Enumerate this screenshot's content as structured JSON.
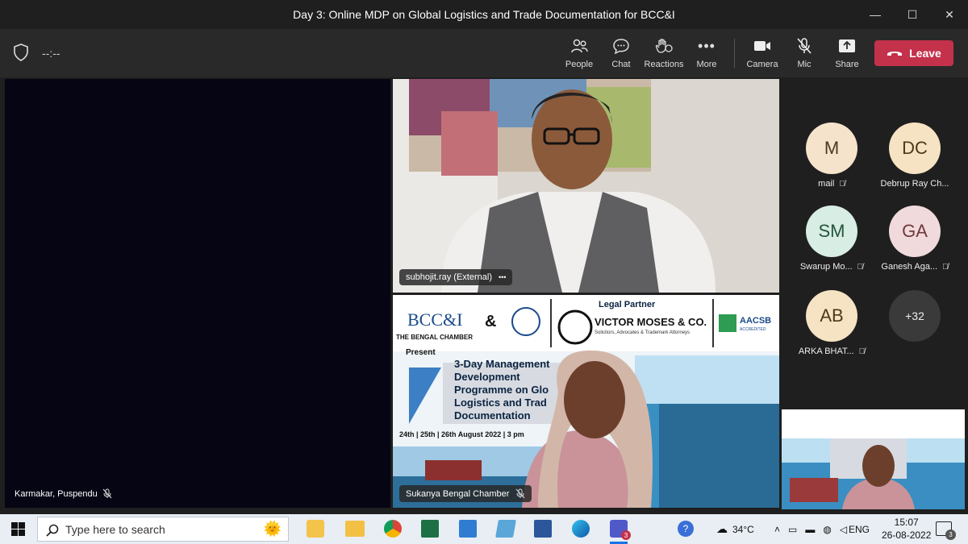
{
  "window": {
    "title": "Day 3: Online MDP on Global Logistics and Trade Documentation for BCC&I",
    "controls": [
      "—",
      "☐",
      "✕"
    ]
  },
  "toolbar": {
    "timer": "--:--",
    "people_label": "People",
    "chat_label": "Chat",
    "reactions_label": "Reactions",
    "more_label": "More",
    "camera_label": "Camera",
    "mic_label": "Mic",
    "share_label": "Share",
    "leave_label": "Leave"
  },
  "participants_main": {
    "left_name": "Karmakar, Puspendu",
    "top_name": "subhojit.ray (External)",
    "top_more": "•••",
    "bottom_name": "Sukanya Bengal Chamber"
  },
  "slide": {
    "bcc_logo": "BCC&I",
    "bcc_sub": "THE BENGAL CHAMBER",
    "amp": "&",
    "legal_partner": "Legal Partner",
    "firm": "VICTOR MOSES & CO.",
    "firm_sub": "Solicitors, Advocates & Trademark Attorneys",
    "aacsb": "AACSB",
    "aacsb_sub": "ACCREDITED",
    "present": "Present",
    "headline_lines": [
      "3-Day Management",
      "Development",
      "Programme on Glo",
      "Logistics and Trad",
      "Documentation"
    ],
    "dates": "24th | 25th | 26th August 2022 | 3 pm"
  },
  "roster": [
    {
      "initials": "M",
      "name": "mail",
      "color": "#f6e3cc"
    },
    {
      "initials": "DC",
      "name": "Debrup Ray Ch...",
      "color": "#f6e3c3"
    },
    {
      "initials": "SM",
      "name": "Swarup Mo...",
      "color": "#d8ede3"
    },
    {
      "initials": "GA",
      "name": "Ganesh Aga...",
      "color": "#f1dadb"
    },
    {
      "initials": "AB",
      "name": "ARKA BHAT...",
      "color": "#f6e3c3"
    },
    {
      "initials": "+32",
      "name": "",
      "color": "#3a3a3a"
    }
  ],
  "taskbar": {
    "search_placeholder": "Type here to search",
    "weather": "34°C",
    "lang": "ENG",
    "time": "15:07",
    "date": "26-08-2022",
    "notif_count": "3",
    "teams_badge": "3"
  }
}
